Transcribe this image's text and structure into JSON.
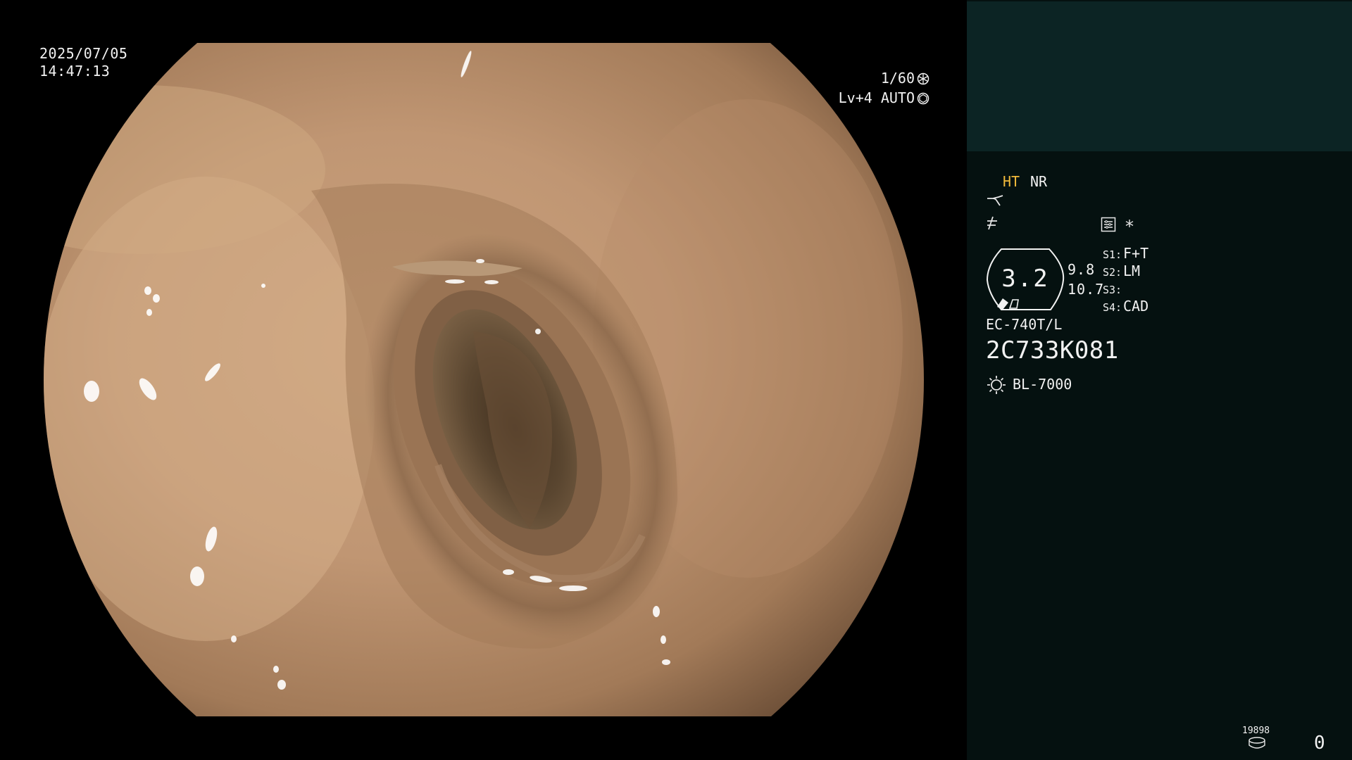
{
  "display": {
    "date": "2025/07/05",
    "time": "14:47:13"
  },
  "exposure": {
    "shutter": "1/60",
    "level": "Lv+4 AUTO"
  },
  "status": {
    "ht": "HT",
    "nr": "NR",
    "gauge_value": "3.2",
    "side_value_1": "9.8",
    "side_value_2": "10.7",
    "switches": [
      {
        "label": "S1:",
        "value": "F+T"
      },
      {
        "label": "S2:",
        "value": "LM"
      },
      {
        "label": "S3:",
        "value": ""
      },
      {
        "label": "S4:",
        "value": "CAD"
      }
    ],
    "asterisk": "*"
  },
  "scope": {
    "model": "EC-740T/L",
    "serial": "2C733K081",
    "light_source": "BL-7000"
  },
  "storage": {
    "counter": "19898",
    "image_count": "0"
  },
  "icons": [
    "shutter-icon",
    "auto-iris-icon",
    "enhance-curve-icon",
    "color-tone-icon",
    "menu-icon",
    "gauge-icon",
    "light-source-icon",
    "disk-icon"
  ]
}
